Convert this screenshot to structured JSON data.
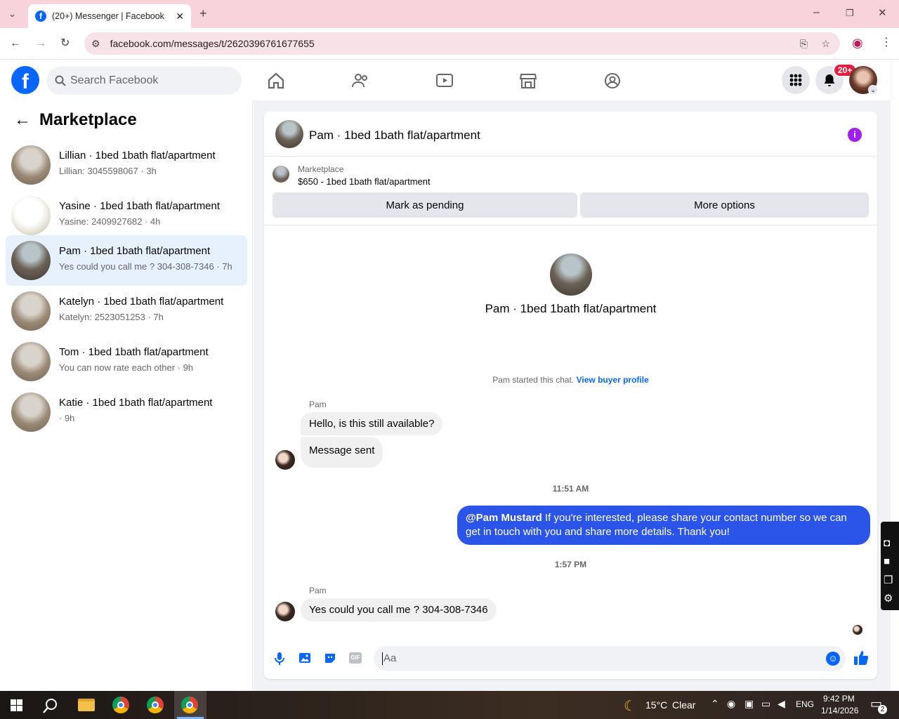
{
  "browser": {
    "tab_title": "(20+) Messenger | Facebook",
    "url": "facebook.com/messages/t/2620396761677655"
  },
  "header": {
    "search_placeholder": "Search Facebook",
    "notif_badge": "20+"
  },
  "sidebar": {
    "title": "Marketplace",
    "conversations": [
      {
        "title": "Lillian · 1bed 1bath flat/apartment",
        "preview": "Lillian: 3045598067 · 3h"
      },
      {
        "title": "Yasine · 1bed 1bath flat/apartment",
        "preview": "Yasine: 2409927682 · 4h"
      },
      {
        "title": "Pam · 1bed 1bath flat/apartment",
        "preview": "Yes could you call me ? 304-308-7346 · 7h"
      },
      {
        "title": "Katelyn · 1bed 1bath flat/apartment",
        "preview": "Katelyn: 2523051253 · 7h"
      },
      {
        "title": "Tom · 1bed 1bath flat/apartment",
        "preview": "You can now rate each other · 9h"
      },
      {
        "title": "Katie · 1bed 1bath flat/apartment",
        "preview": " · 9h"
      }
    ]
  },
  "chat": {
    "title": "Pam · 1bed 1bath flat/apartment",
    "listing_source": "Marketplace",
    "listing": "$650 - 1bed 1bath flat/apartment",
    "mark_pending": "Mark as pending",
    "more_options": "More options",
    "profile_name": "Pam · 1bed 1bath flat/apartment",
    "started": "Pam started this chat.",
    "view_profile": "View buyer profile",
    "sender1": "Pam",
    "msg1": "Hello, is this still available?",
    "msg2": "Message sent",
    "time1": "11:51 AM",
    "mine_mention": "@Pam Mustard",
    "mine_text": " If you're interested, please share your contact number so we can get in touch with you and share more details. Thank you!",
    "time2": "1:57 PM",
    "sender2": "Pam",
    "msg3": "Yes could you call me ? 304-308-7346",
    "composer_placeholder": "Aa"
  },
  "taskbar": {
    "temp": "15°C",
    "weather": "Clear",
    "lang": "ENG",
    "time": "9:42 PM",
    "date": "1/14/2026",
    "notif_count": "2"
  },
  "colors": {
    "fb_blue": "#0866ff",
    "bubble_mine": "#2b54e9",
    "badge_red": "#e41e3f",
    "info_purple": "#a020f0"
  }
}
